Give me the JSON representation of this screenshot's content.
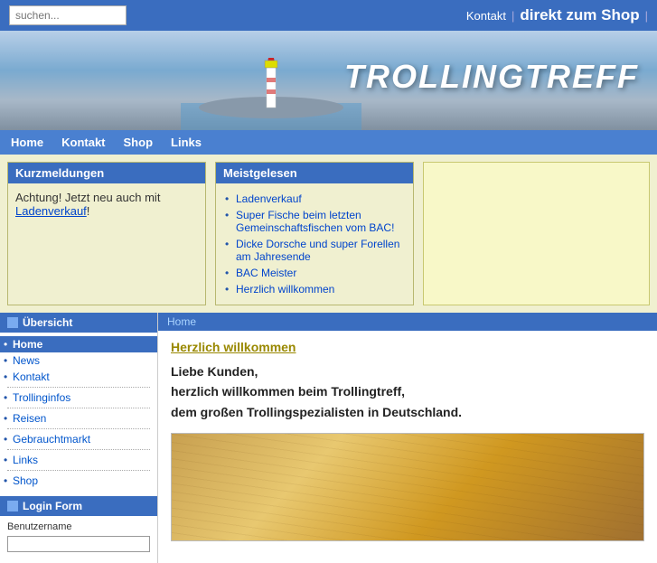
{
  "topbar": {
    "search_placeholder": "suchen...",
    "kontakt_label": "Kontakt",
    "shop_label": "direkt zum Shop"
  },
  "banner": {
    "title": "TROLLINGTREFF"
  },
  "nav": {
    "items": [
      {
        "label": "Home",
        "href": "#"
      },
      {
        "label": "Kontakt",
        "href": "#"
      },
      {
        "label": "Shop",
        "href": "#"
      },
      {
        "label": "Links",
        "href": "#"
      }
    ]
  },
  "panels": {
    "kurz": {
      "header": "Kurzmeldungen",
      "body": "Achtung! Jetzt neu auch mit ",
      "link_text": "Ladenverkauf",
      "body_suffix": "!"
    },
    "meist": {
      "header": "Meistgelesen",
      "items": [
        "Ladenverkauf",
        "Super Fische beim letzten Gemeinschaftsfischen vom BAC!",
        "Dicke Dorsche und super Forellen am Jahresende",
        "BAC Meister",
        "Herzlich willkommen"
      ]
    }
  },
  "sidebar": {
    "uebersicht_label": "Übersicht",
    "nav_items": [
      {
        "label": "Home",
        "active": true
      },
      {
        "label": "News",
        "active": false
      },
      {
        "label": "Kontakt",
        "active": false
      },
      {
        "label": "Trollinginfos",
        "active": false
      },
      {
        "label": "Reisen",
        "active": false
      },
      {
        "label": "Gebrauchtmarkt",
        "active": false
      },
      {
        "label": "Links",
        "active": false
      },
      {
        "label": "Shop",
        "active": false
      }
    ],
    "login_header": "Login Form",
    "benutzername_label": "Benutzername"
  },
  "content": {
    "breadcrumb": "Home",
    "title": "Herzlich willkommen",
    "text_line1": "Liebe Kunden,",
    "text_line2": "herzlich willkommen beim Trollingtreff,",
    "text_line3": "dem großen Trollingspezialisten in Deutschland."
  }
}
